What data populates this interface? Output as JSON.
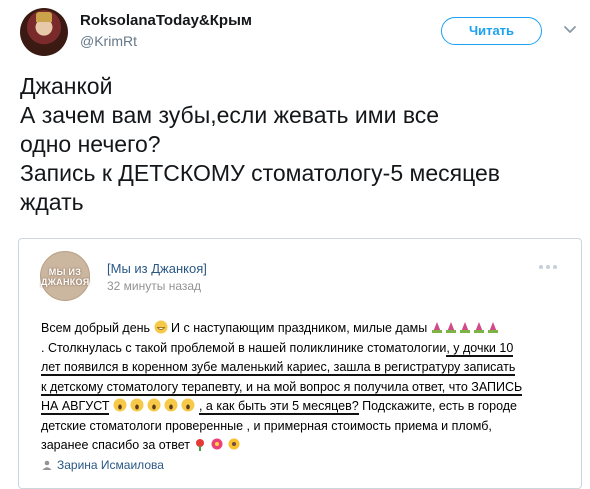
{
  "author": {
    "name": "RoksolanaToday&Крым",
    "handle": "@KrimRt",
    "follow_label": "Читать"
  },
  "tweet": {
    "lines": [
      "Джанкой",
      "А зачем вам зубы,если жевать ими все",
      "одно нечего?",
      "Запись к ДЕТСКОМУ стоматологу-5 месяцев",
      "ждать"
    ]
  },
  "embed": {
    "avatar_text_1": "МЫ ИЗ",
    "avatar_text_2": "ДЖАНКОЯ",
    "group_name": "[Мы из Джанкоя]",
    "time": "32 минуты назад",
    "post": {
      "l1": "Всем добрый день",
      "l1b": " И с наступающим праздником, милые дамы",
      "l2a": ". Столкнулась с такой проблемой в нашей поликлинике стоматологии",
      "l2b": ", у дочки 10",
      "l3": "лет появился в коренном зубе маленький кариес, зашла в регистратуру записать",
      "l4": "к детскому стоматологу терапевту, и на мой вопрос я получила ответ, что ЗАПИСЬ",
      "l5a": "НА АВГУСТ",
      "l5b": ", а как быть эти 5 месяцев?",
      "l5c": " Подскажите, есть в городе",
      "l6": "детские стоматологи проверенные , и примерная стоимость приема и пломб,",
      "l7": "заранее спасибо за ответ"
    },
    "author": "Зарина Исмаилова"
  },
  "icons": {
    "chevron": "chevron-down-icon",
    "more": "more-icon",
    "person": "person-icon",
    "emoji_grin": "grinning-face-emoji",
    "emoji_dancer": "dancing-woman-emoji",
    "emoji_scream": "screaming-face-emoji",
    "emoji_flowers": "flower-emoji"
  },
  "colors": {
    "accent": "#1da1f2",
    "vk_link": "#2a5885",
    "muted": "#657786"
  }
}
